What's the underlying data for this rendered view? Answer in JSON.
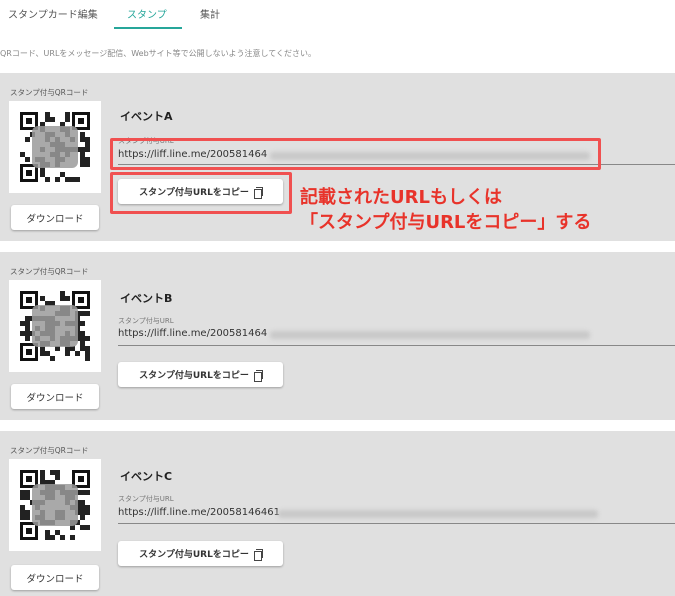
{
  "tabs": [
    {
      "label": "スタンプカード編集"
    },
    {
      "label": "スタンプ"
    },
    {
      "label": "集計"
    }
  ],
  "notice": "QRコード、URLをメッセージ配信、Webサイト等で公開しないよう注意してください。",
  "cards": [
    {
      "qr_label": "スタンプ付与QRコード",
      "title": "イベントA",
      "url_label": "スタンプ付与URL",
      "url": "https://liff.line.me/200581464",
      "copy_label": "スタンプ付与URLをコピー",
      "download_label": "ダウンロード"
    },
    {
      "qr_label": "スタンプ付与QRコード",
      "title": "イベントB",
      "url_label": "スタンプ付与URL",
      "url": "https://liff.line.me/200581464",
      "copy_label": "スタンプ付与URLをコピー",
      "download_label": "ダウンロード"
    },
    {
      "qr_label": "スタンプ付与QRコード",
      "title": "イベントC",
      "url_label": "スタンプ付与URL",
      "url": "https://liff.line.me/20058146461",
      "copy_label": "スタンプ付与URLをコピー",
      "download_label": "ダウンロード"
    }
  ],
  "annotation": {
    "line1": "記載されたURLもしくは",
    "line2": "「スタンプ付与URLをコピー」する"
  },
  "colors": {
    "accent": "#26a69a",
    "highlight": "#f05050",
    "annotation": "#e8332a"
  }
}
